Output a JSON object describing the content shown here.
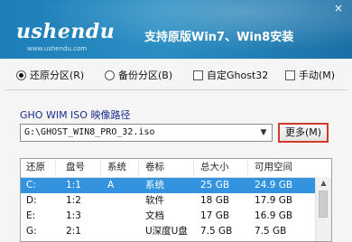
{
  "header": {
    "logo_text": "ushendu",
    "logo_sub": "www.ushendu.com",
    "title": "支持原版Win7、Win8安装",
    "close_glyph": "×"
  },
  "mode_options": [
    {
      "label": "还原分区(R)",
      "type": "radio",
      "checked": true
    },
    {
      "label": "备份分区(B)",
      "type": "radio",
      "checked": false
    },
    {
      "label": "自定Ghost32",
      "type": "checkbox",
      "checked": false
    },
    {
      "label": "手动(M)",
      "type": "checkbox",
      "checked": false
    }
  ],
  "image_path": {
    "label": "GHO WIM ISO 映像路径",
    "value": "G:\\GHOST_WIN8_PRO_32.iso",
    "more_button": "更多(M)"
  },
  "partition_table": {
    "columns": [
      "还原",
      "盘号",
      "系统",
      "卷标",
      "总大小",
      "可用空间"
    ],
    "rows": [
      {
        "drive": "C:",
        "disk": "1:1",
        "system": "A",
        "label": "系统",
        "total": "25 GB",
        "free": "24.9 GB",
        "selected": true
      },
      {
        "drive": "D:",
        "disk": "1:2",
        "system": "",
        "label": "软件",
        "total": "18 GB",
        "free": "17.9 GB",
        "selected": false
      },
      {
        "drive": "E:",
        "disk": "1:3",
        "system": "",
        "label": "文档",
        "total": "17 GB",
        "free": "16.9 GB",
        "selected": false
      },
      {
        "drive": "G:",
        "disk": "2:1",
        "system": "",
        "label": "U深度U盘",
        "total": "7.5 GB",
        "free": "7.5 GB",
        "selected": false
      }
    ]
  },
  "colors": {
    "header_bg": "#1d7eb8",
    "selection": "#3393df",
    "more_border": "#d03a2a"
  }
}
